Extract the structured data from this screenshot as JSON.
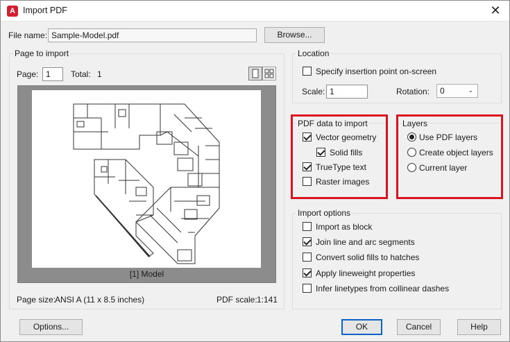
{
  "window": {
    "title": "Import PDF",
    "app_icon_letter": "A"
  },
  "file": {
    "label": "File name:",
    "value": "Sample-Model.pdf",
    "browse_label": "Browse..."
  },
  "page_to_import": {
    "title": "Page to import",
    "page_label": "Page:",
    "page_value": "1",
    "total_label": "Total:",
    "total_value": "1",
    "preview_caption": "[1] Model",
    "page_size_label": "Page size:",
    "page_size_value": "ANSI A (11 x 8.5 inches)",
    "pdf_scale_label": "PDF scale:",
    "pdf_scale_value": "1:141"
  },
  "location": {
    "title": "Location",
    "specify_label": "Specify insertion point on-screen",
    "specify_checked": false,
    "scale_label": "Scale:",
    "scale_value": "1",
    "rotation_label": "Rotation:",
    "rotation_value": "0"
  },
  "pdf_data": {
    "title": "PDF data to import",
    "items": [
      {
        "label": "Vector geometry",
        "checked": true
      },
      {
        "label": "Solid fills",
        "checked": true
      },
      {
        "label": "TrueType text",
        "checked": true
      },
      {
        "label": "Raster images",
        "checked": false
      }
    ]
  },
  "layers": {
    "title": "Layers",
    "options": [
      {
        "label": "Use PDF layers",
        "selected": true
      },
      {
        "label": "Create object layers",
        "selected": false
      },
      {
        "label": "Current layer",
        "selected": false
      }
    ]
  },
  "import_options": {
    "title": "Import options",
    "items": [
      {
        "label": "Import as block",
        "checked": false
      },
      {
        "label": "Join line and arc segments",
        "checked": true
      },
      {
        "label": "Convert solid fills to hatches",
        "checked": false
      },
      {
        "label": "Apply lineweight properties",
        "checked": true
      },
      {
        "label": "Infer linetypes from collinear dashes",
        "checked": false
      }
    ]
  },
  "buttons": {
    "options": "Options...",
    "ok": "OK",
    "cancel": "Cancel",
    "help": "Help"
  },
  "colors": {
    "highlight": "#d9131f",
    "accent": "#0a64c8",
    "app_icon": "#d11f2f"
  }
}
